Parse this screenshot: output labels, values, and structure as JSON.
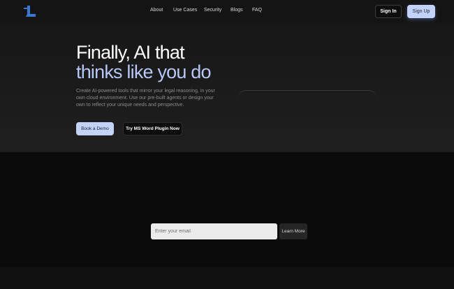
{
  "colors": {
    "accent": "#c3d2fb",
    "accent_text": "#b7c7f6",
    "logo_blue": "#3b78d6",
    "background": "#0b0b0b",
    "hero_background": "#1c1c1c"
  },
  "nav": {
    "logo_icon": "logo-l-icon",
    "links": [
      {
        "label": "About"
      },
      {
        "label": "Use Cases"
      },
      {
        "label": "Security"
      },
      {
        "label": "Blogs"
      },
      {
        "label": "FAQ"
      }
    ],
    "sign_in": "Sign In",
    "sign_up": "Sign Up"
  },
  "hero": {
    "title_line1": "Finally, AI that",
    "title_line2": "thinks like you do",
    "description": "Create AI-powered tools that mirror your legal reasoning, in your own cloud environment. Use our pre-built agents or design your own to reflect your unique needs and perspective.",
    "primary_button": "Book a Demo",
    "secondary_button": "Try MS Word Plugin Now"
  },
  "newsletter": {
    "email_placeholder": "Enter your email",
    "button": "Learn More"
  }
}
